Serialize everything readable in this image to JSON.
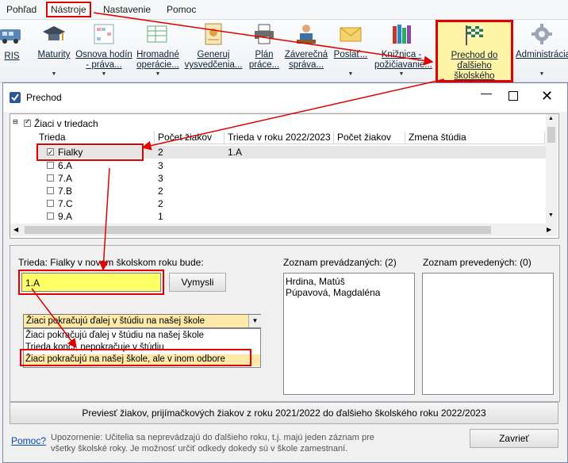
{
  "menu": [
    "Pohľad",
    "Nástroje",
    "Nastavenie",
    "Pomoc"
  ],
  "ribbon": [
    {
      "label": "RIS"
    },
    {
      "label": "Maturity"
    },
    {
      "label": "Osnova hodín - práva..."
    },
    {
      "label": "Hromadné operácie..."
    },
    {
      "label": "Generuj vysvedčenia..."
    },
    {
      "label": "Plán práce..."
    },
    {
      "label": "Záverečná správa..."
    },
    {
      "label": "Poslať..."
    },
    {
      "label": "Knižnica - požičiavanie..."
    },
    {
      "label": "Prechod do ďalšieho školského roku..."
    },
    {
      "label": "Administrácia"
    }
  ],
  "dialog": {
    "title": "Prechod",
    "tree_root": "Žiaci v triedach",
    "columns": [
      "Trieda",
      "Počet žiakov",
      "Trieda v roku 2022/2023",
      "Počet žiakov",
      "Zmena štúdia"
    ],
    "rows": [
      {
        "trieda": "Fialky",
        "pocet": "2",
        "nova": "1.A",
        "checked": true
      },
      {
        "trieda": "6.A",
        "pocet": "3",
        "nova": "",
        "checked": false
      },
      {
        "trieda": "7.A",
        "pocet": "3",
        "nova": "",
        "checked": false
      },
      {
        "trieda": "7.B",
        "pocet": "2",
        "nova": "",
        "checked": false
      },
      {
        "trieda": "7.C",
        "pocet": "2",
        "nova": "",
        "checked": false
      },
      {
        "trieda": "9.A",
        "pocet": "1",
        "nova": "",
        "checked": false
      }
    ],
    "trieda_label": "Trieda: Fialky v novom školskom roku bude:",
    "trieda_value": "1.A",
    "vymysli_label": "Vymysli",
    "prevadzanych_label": "Zoznam prevádzaných: (2)",
    "prevadzanych": [
      "Hrdina, Matúš",
      "Púpavová, Magdaléna"
    ],
    "prevedenych_label": "Zoznam prevedených: (0)",
    "combo_selected": "Žiaci pokračujú ďalej v štúdiu na našej škole",
    "combo_options": [
      "Žiaci pokračujú ďalej v štúdiu na našej škole",
      "Trieda končí, nepokračuje v štúdiu",
      "Žiaci pokračujú na našej škole, ale v inom odbore"
    ],
    "prevest_label": "Previesť žiakov, prijímačkových žiakov z roku 2021/2022 do ďalšieho školského roku 2022/2023",
    "pomoc_label": "Pomoc?",
    "note": "Upozornenie: Učitelia sa neprevádzajú do ďalšieho roku, t.j. majú jeden záznam pre všetky školské roky. Je možnosť určiť odkedy dokedy sú v škole zamestnaní.",
    "zavriet_label": "Zavrieť"
  },
  "colors": {
    "highlight": "#ffff66",
    "annotation": "#e00000",
    "selection": "#3399ff"
  }
}
